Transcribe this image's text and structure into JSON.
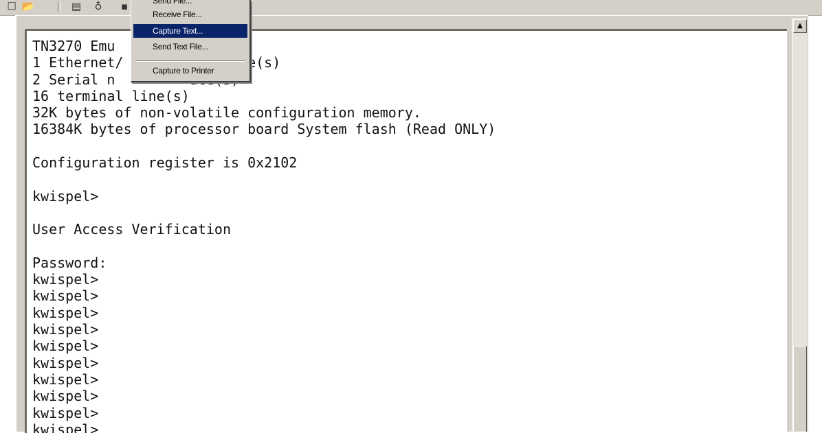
{
  "menu": {
    "items": [
      {
        "label": "Send File..."
      },
      {
        "label": "Receive File..."
      },
      {
        "label": "Capture Text..."
      },
      {
        "label": "Send Text File..."
      },
      {
        "label": "Capture to Printer"
      }
    ]
  },
  "terminal": {
    "lines": [
      "TN3270 Emu         re.",
      "1 Ethernet/        nterface(s)",
      "2 Serial n         ace(s)",
      "16 terminal line(s)",
      "32K bytes of non-volatile configuration memory.",
      "16384K bytes of processor board System flash (Read ONLY)",
      "",
      "Configuration register is 0x2102",
      "",
      "kwispel>",
      "",
      "User Access Verification",
      "",
      "Password:",
      "kwispel>",
      "kwispel>",
      "kwispel>",
      "kwispel>",
      "kwispel>",
      "kwispel>",
      "kwispel>",
      "kwispel>",
      "kwispel>",
      "kwispel>"
    ]
  },
  "icons": {
    "new": "new-document-icon",
    "open": "open-folder-icon",
    "properties": "properties-icon",
    "disconnect": "disconnect-icon",
    "scroll_up": "scroll-up-arrow-icon"
  }
}
